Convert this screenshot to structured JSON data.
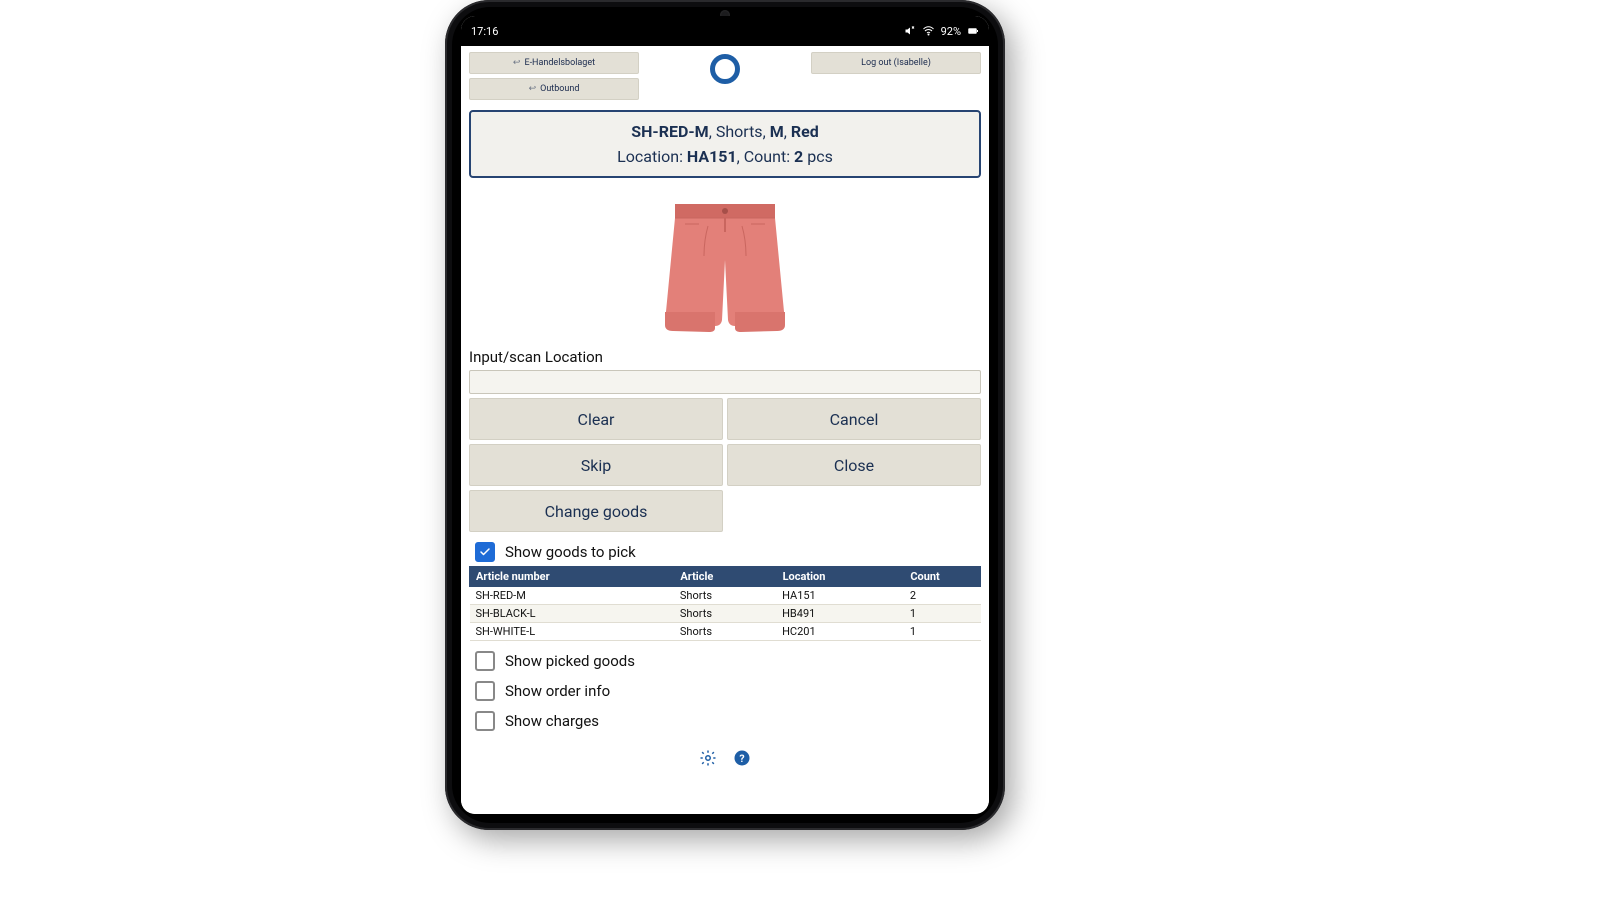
{
  "statusbar": {
    "time": "17:16",
    "battery_pct": "92%"
  },
  "nav": {
    "company": "E-Handelsbolaget",
    "mode": "Outbound",
    "logout": "Log out (Isabelle)"
  },
  "item": {
    "sku": "SH-RED-M",
    "type": "Shorts",
    "size": "M",
    "color": "Red",
    "location_label": "Location:",
    "location": "HA151",
    "count_label": "Count:",
    "count": "2",
    "count_unit": "pcs"
  },
  "input": {
    "label": "Input/scan Location",
    "value": ""
  },
  "actions": {
    "clear": "Clear",
    "cancel": "Cancel",
    "skip": "Skip",
    "close": "Close",
    "change_goods": "Change goods"
  },
  "checks": {
    "show_to_pick": "Show goods to pick",
    "show_picked": "Show picked goods",
    "show_order_info": "Show order info",
    "show_charges": "Show charges"
  },
  "table": {
    "headers": {
      "article_number": "Article number",
      "article": "Article",
      "location": "Location",
      "count": "Count"
    },
    "rows": [
      {
        "article_number": "SH-RED-M",
        "article": "Shorts",
        "location": "HA151",
        "count": "2"
      },
      {
        "article_number": "SH-BLACK-L",
        "article": "Shorts",
        "location": "HB491",
        "count": "1"
      },
      {
        "article_number": "SH-WHITE-L",
        "article": "Shorts",
        "location": "HC201",
        "count": "1"
      }
    ]
  },
  "colors": {
    "brand_blue": "#1e5ea6",
    "panel_border": "#274472",
    "btn_bg": "#e3e0d6"
  }
}
